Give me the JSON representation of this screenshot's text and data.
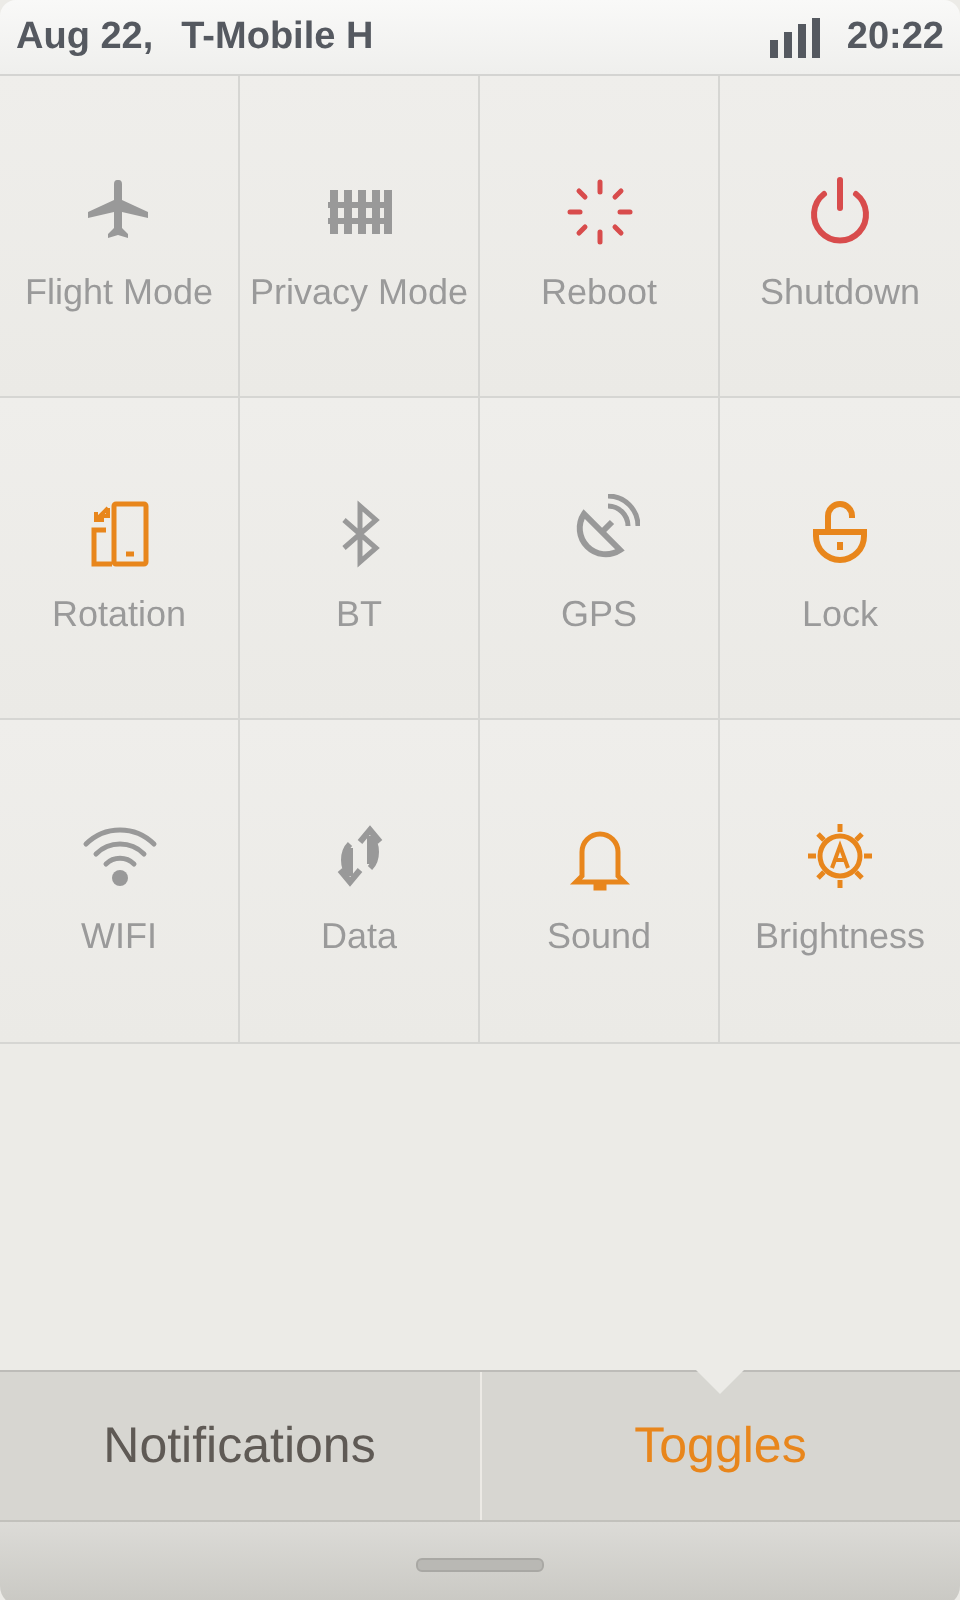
{
  "status_bar": {
    "date": "Aug 22,",
    "carrier": "T-Mobile H",
    "time": "20:22"
  },
  "toggles": [
    {
      "label": "Flight Mode",
      "kind": "toggle",
      "on": false
    },
    {
      "label": "Privacy Mode",
      "kind": "toggle",
      "on": false
    },
    {
      "label": "Reboot",
      "kind": "action"
    },
    {
      "label": "Shutdown",
      "kind": "action"
    },
    {
      "label": "Rotation",
      "kind": "toggle",
      "on": true
    },
    {
      "label": "BT",
      "kind": "toggle",
      "on": false
    },
    {
      "label": "GPS",
      "kind": "toggle",
      "on": false
    },
    {
      "label": "Lock",
      "kind": "toggle",
      "on": true
    },
    {
      "label": "WIFI",
      "kind": "toggle",
      "on": false
    },
    {
      "label": "Data",
      "kind": "toggle",
      "on": false
    },
    {
      "label": "Sound",
      "kind": "toggle",
      "on": true
    },
    {
      "label": "Brightness",
      "kind": "toggle",
      "on": true
    }
  ],
  "tabs": [
    {
      "label": "Notifications",
      "selected": false
    },
    {
      "label": "Toggles",
      "selected": true
    }
  ]
}
